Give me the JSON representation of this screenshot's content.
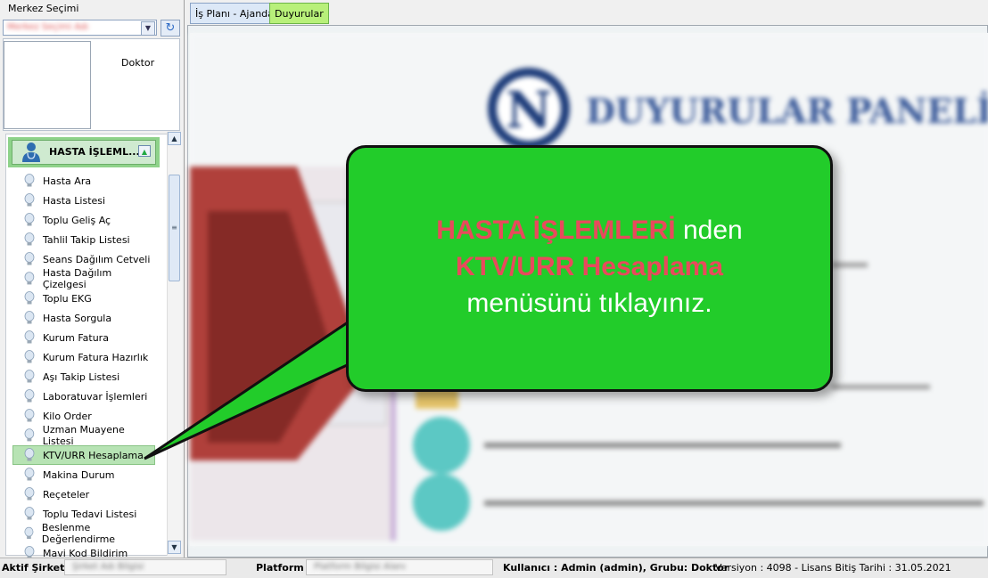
{
  "sidebar": {
    "center_label": "Merkez Seçimi",
    "center_value": "Merkez Seçimi Adı",
    "doctor_label": "Doktor",
    "section_title": "HASTA İŞLEML...",
    "items": [
      {
        "label": "Hasta Ara"
      },
      {
        "label": "Hasta Listesi"
      },
      {
        "label": "Toplu Geliş Aç"
      },
      {
        "label": "Tahlil Takip Listesi"
      },
      {
        "label": "Seans Dağılım Cetveli"
      },
      {
        "label": "Hasta Dağılım Çizelgesi"
      },
      {
        "label": "Toplu EKG"
      },
      {
        "label": "Hasta Sorgula"
      },
      {
        "label": "Kurum Fatura"
      },
      {
        "label": "Kurum Fatura Hazırlık"
      },
      {
        "label": "Aşı Takip Listesi"
      },
      {
        "label": "Laboratuvar İşlemleri"
      },
      {
        "label": "Kilo Order"
      },
      {
        "label": "Uzman Muayene Listesi"
      },
      {
        "label": "KTV/URR Hesaplama",
        "selected": true
      },
      {
        "label": "Makina Durum"
      },
      {
        "label": "Reçeteler"
      },
      {
        "label": "Toplu Tedavi Listesi"
      },
      {
        "label": "Beslenme Değerlendirme"
      },
      {
        "label": "Mavi Kod Bildirim"
      }
    ]
  },
  "tabs": [
    {
      "label": "İş Planı - Ajanda"
    },
    {
      "label": "Duyurular"
    }
  ],
  "content": {
    "panel_title": "DUYURULAR PANELİ",
    "logo_letter": "N"
  },
  "callout": {
    "part1_red": "HASTA İŞLEMLERİ",
    "part1_rest": " nden",
    "part2_red": "KTV/URR Hesaplama",
    "part3": "menüsünü tıklayınız."
  },
  "status": {
    "company_label": "Aktif Şirket",
    "company_value": "Şirket Adı Bilgisi",
    "platform_label": "Platform",
    "platform_value": "Platform Bilgisi Alanı",
    "user_text": "Kullanıcı : Admin (admin), Grubu: Doktor",
    "version_text": "Versiyon : 4098 - Lisans Bitiş Tarihi : 31.05.2021"
  },
  "colors": {
    "accent_green": "#22cc2a",
    "highlight_red": "#e84a5c",
    "selected_row": "#b7e3b4"
  }
}
